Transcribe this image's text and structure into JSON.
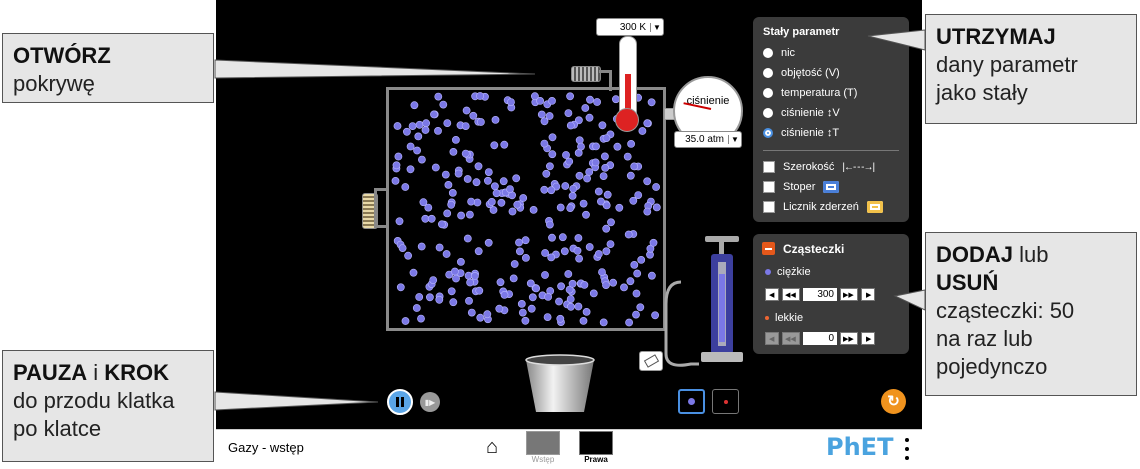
{
  "callouts": {
    "lid": {
      "bold": "OTWÓRZ",
      "text": "pokrywę"
    },
    "hold": {
      "bold": "UTRZYMAJ",
      "text": "dany parametr jako stały"
    },
    "add": {
      "bold1": "DODAJ",
      "mid": " lub ",
      "bold2": "USUŃ",
      "text": "cząsteczki: 50 na raz lub pojedynczo"
    },
    "pause": {
      "bold1": "PAUZA",
      "mid": " i ",
      "bold2": "KROK",
      "text": "do przodu klatka po klatce"
    }
  },
  "thermometer": {
    "value": "300 K"
  },
  "gauge": {
    "label": "ciśnienie",
    "value": "35.0 atm"
  },
  "constant_panel": {
    "title": "Stały parametr",
    "options": [
      "nic",
      "objętość (V)",
      "temperatura (T)",
      "ciśnienie ↕V",
      "ciśnienie ↕T"
    ],
    "selected_index": 4,
    "checkboxes": [
      "Szerokość",
      "Stoper",
      "Licznik zderzeń"
    ]
  },
  "particles_panel": {
    "title": "Cząsteczki",
    "heavy_label": "ciężkie",
    "heavy_count": "300",
    "light_label": "lekkie",
    "light_count": "0"
  },
  "navbar": {
    "title": "Gazy - wstęp",
    "screens": [
      {
        "label": "Wstęp",
        "active": false
      },
      {
        "label": "Prawa",
        "active": true
      }
    ],
    "brand": "PhET"
  },
  "colors": {
    "particle": "#7b78e6",
    "sim_bg": "#000000",
    "panel_bg": "#3b3b3b",
    "reset_orange": "#f0931e",
    "pause_blue": "#5ba6e8"
  },
  "icons": [
    "home-icon",
    "pause-icon",
    "step-icon",
    "reset-icon",
    "eraser-icon",
    "menu-icon",
    "minus-icon",
    "stopwatch-icon",
    "counter-icon",
    "width-icon"
  ]
}
